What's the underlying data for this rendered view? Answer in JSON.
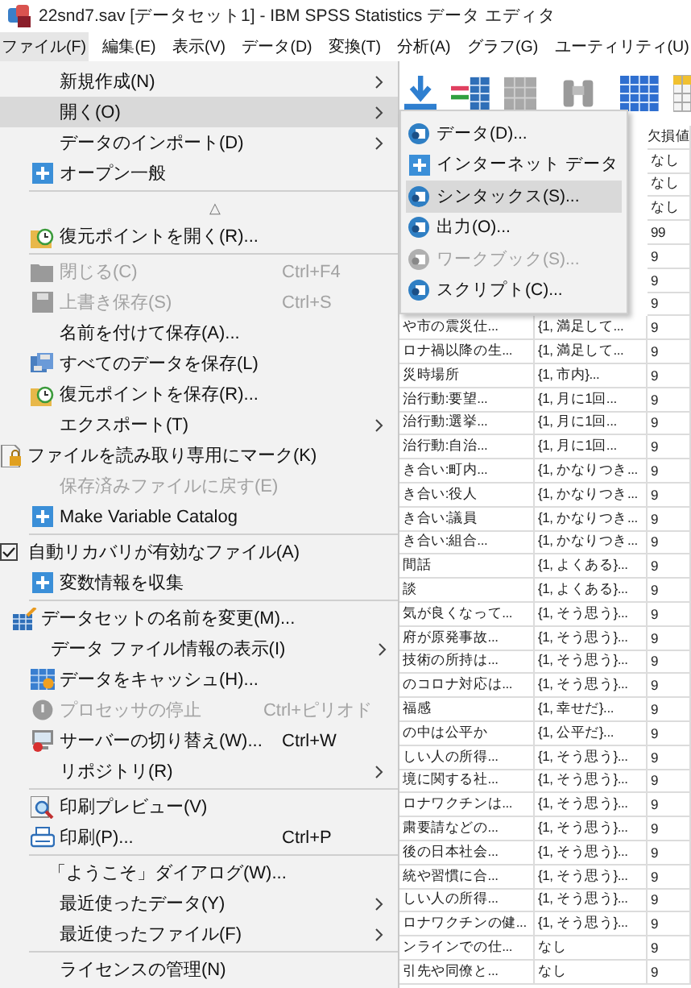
{
  "window": {
    "title": "22snd7.sav [データセット1] - IBM SPSS Statistics データ エディタ"
  },
  "menubar": [
    {
      "label": "ファイル(F)",
      "selected": true
    },
    {
      "label": "編集(E)",
      "selected": false
    },
    {
      "label": "表示(V)",
      "selected": false
    },
    {
      "label": "データ(D)",
      "selected": false
    },
    {
      "label": "変換(T)",
      "selected": false
    },
    {
      "label": "分析(A)",
      "selected": false
    },
    {
      "label": "グラフ(G)",
      "selected": false
    },
    {
      "label": "ユーティリティ(U)",
      "selected": false
    }
  ],
  "file_menu": {
    "items": [
      {
        "kind": "item",
        "label": "新規作成(N)",
        "has_submenu": true,
        "selected": false,
        "disabled": false
      },
      {
        "kind": "item",
        "label": "開く(O)",
        "has_submenu": true,
        "selected": true,
        "disabled": false
      },
      {
        "kind": "item",
        "label": "データのインポート(D)",
        "has_submenu": true,
        "selected": false,
        "disabled": false
      },
      {
        "kind": "item",
        "label": "オープン一般",
        "selected": false,
        "disabled": false
      },
      {
        "kind": "separator"
      },
      {
        "kind": "more",
        "label": "△"
      },
      {
        "kind": "item",
        "label": "復元ポイントを開く(R)...",
        "selected": false,
        "disabled": false
      },
      {
        "kind": "separator"
      },
      {
        "kind": "item",
        "label": "閉じる(C)",
        "shortcut": "Ctrl+F4",
        "selected": false,
        "disabled": true
      },
      {
        "kind": "item",
        "label": "上書き保存(S)",
        "shortcut": "Ctrl+S",
        "selected": false,
        "disabled": true
      },
      {
        "kind": "item",
        "label": "名前を付けて保存(A)...",
        "selected": false,
        "disabled": false
      },
      {
        "kind": "item",
        "label": "すべてのデータを保存(L)",
        "selected": false,
        "disabled": false
      },
      {
        "kind": "item",
        "label": "復元ポイントを保存(R)...",
        "selected": false,
        "disabled": false
      },
      {
        "kind": "item",
        "label": "エクスポート(T)",
        "has_submenu": true,
        "selected": false,
        "disabled": false
      },
      {
        "kind": "item",
        "label": "ファイルを読み取り専用にマーク(K)",
        "selected": false,
        "disabled": false
      },
      {
        "kind": "item",
        "label": "保存済みファイルに戻す(E)",
        "selected": false,
        "disabled": true
      },
      {
        "kind": "item",
        "label": "Make Variable Catalog",
        "selected": false,
        "disabled": false
      },
      {
        "kind": "separator"
      },
      {
        "kind": "check",
        "label": "自動リカバリが有効なファイル(A)",
        "checked": true,
        "selected": false,
        "disabled": false
      },
      {
        "kind": "item",
        "label": "変数情報を収集",
        "selected": false,
        "disabled": false
      },
      {
        "kind": "separator"
      },
      {
        "kind": "item",
        "label": "データセットの名前を変更(M)...",
        "selected": false,
        "disabled": false
      },
      {
        "kind": "item",
        "label": "データ ファイル情報の表示(I)",
        "has_submenu": true,
        "selected": false,
        "disabled": false
      },
      {
        "kind": "item",
        "label": "データをキャッシュ(H)...",
        "selected": false,
        "disabled": false
      },
      {
        "kind": "item",
        "label": "プロセッサの停止",
        "shortcut": "Ctrl+ピリオド",
        "selected": false,
        "disabled": true
      },
      {
        "kind": "item",
        "label": "サーバーの切り替え(W)...",
        "shortcut": "Ctrl+W",
        "selected": false,
        "disabled": false
      },
      {
        "kind": "item",
        "label": "リポジトリ(R)",
        "has_submenu": true,
        "selected": false,
        "disabled": false
      },
      {
        "kind": "separator"
      },
      {
        "kind": "item",
        "label": "印刷プレビュー(V)",
        "selected": false,
        "disabled": false
      },
      {
        "kind": "item",
        "label": "印刷(P)...",
        "shortcut": "Ctrl+P",
        "selected": false,
        "disabled": false
      },
      {
        "kind": "separator"
      },
      {
        "kind": "item",
        "label": "「ようこそ」ダイアログ(W)...",
        "selected": false,
        "disabled": false
      },
      {
        "kind": "item",
        "label": "最近使ったデータ(Y)",
        "has_submenu": true,
        "selected": false,
        "disabled": false
      },
      {
        "kind": "item",
        "label": "最近使ったファイル(F)",
        "has_submenu": true,
        "selected": false,
        "disabled": false
      },
      {
        "kind": "separator"
      },
      {
        "kind": "item",
        "label": "ライセンスの管理(N)",
        "selected": false,
        "disabled": false
      }
    ]
  },
  "open_submenu": {
    "items": [
      {
        "label": "データ(D)...",
        "selected": false,
        "disabled": false
      },
      {
        "label": "インターネット データ",
        "selected": false,
        "disabled": false
      },
      {
        "label": "シンタックス(S)...",
        "selected": true,
        "disabled": false
      },
      {
        "label": "出力(O)...",
        "selected": false,
        "disabled": false
      },
      {
        "label": "ワークブック(S)...",
        "selected": false,
        "disabled": true
      },
      {
        "label": "スクリプト(C)...",
        "selected": false,
        "disabled": false
      }
    ]
  },
  "grid": {
    "header_column_3": "欠損値",
    "rows": [
      {
        "column_3": "なし"
      },
      {
        "column_3": "なし"
      },
      {
        "column_3": "なし"
      },
      {
        "column_3": "99"
      },
      {
        "column_3": "9"
      },
      {
        "column_3": "9"
      },
      {
        "column_3": "9"
      },
      {
        "column_1": "や市の震災仕...",
        "column_2": "{1, 満足して...",
        "column_3": "9"
      },
      {
        "column_1": "ロナ禍以降の生...",
        "column_2": "{1, 満足して...",
        "column_3": "9"
      },
      {
        "column_1": "災時場所",
        "column_2": "{1, 市内}...",
        "column_3": "9"
      },
      {
        "column_1": "治行動:要望...",
        "column_2": "{1, 月に1回...",
        "column_3": "9"
      },
      {
        "column_1": "治行動:選挙...",
        "column_2": "{1, 月に1回...",
        "column_3": "9"
      },
      {
        "column_1": "治行動:自治...",
        "column_2": "{1, 月に1回...",
        "column_3": "9"
      },
      {
        "column_1": "き合い:町内...",
        "column_2": "{1, かなりつき...",
        "column_3": "9"
      },
      {
        "column_1": "き合い:役人",
        "column_2": "{1, かなりつき...",
        "column_3": "9"
      },
      {
        "column_1": "き合い:議員",
        "column_2": "{1, かなりつき...",
        "column_3": "9"
      },
      {
        "column_1": "き合い:組合...",
        "column_2": "{1, かなりつき...",
        "column_3": "9"
      },
      {
        "column_1": "間話",
        "column_2": "{1, よくある}...",
        "column_3": "9"
      },
      {
        "column_1": "談",
        "column_2": "{1, よくある}...",
        "column_3": "9"
      },
      {
        "column_1": "気が良くなって...",
        "column_2": "{1, そう思う}...",
        "column_3": "9"
      },
      {
        "column_1": "府が原発事故...",
        "column_2": "{1, そう思う}...",
        "column_3": "9"
      },
      {
        "column_1": "技術の所持は...",
        "column_2": "{1, そう思う}...",
        "column_3": "9"
      },
      {
        "column_1": "のコロナ対応は...",
        "column_2": "{1, そう思う}...",
        "column_3": "9"
      },
      {
        "column_1": "福感",
        "column_2": "{1, 幸せだ}...",
        "column_3": "9"
      },
      {
        "column_1": "の中は公平か",
        "column_2": "{1, 公平だ}...",
        "column_3": "9"
      },
      {
        "column_1": "しい人の所得...",
        "column_2": "{1, そう思う}...",
        "column_3": "9"
      },
      {
        "column_1": "境に関する社...",
        "column_2": "{1, そう思う}...",
        "column_3": "9"
      },
      {
        "column_1": "ロナワクチンは...",
        "column_2": "{1, そう思う}...",
        "column_3": "9"
      },
      {
        "column_1": "粛要請などの...",
        "column_2": "{1, そう思う}...",
        "column_3": "9"
      },
      {
        "column_1": "後の日本社会...",
        "column_2": "{1, そう思う}...",
        "column_3": "9"
      },
      {
        "column_1": "統や習慣に合...",
        "column_2": "{1, そう思う}...",
        "column_3": "9"
      },
      {
        "column_1": "しい人の所得...",
        "column_2": "{1, そう思う}...",
        "column_3": "9"
      },
      {
        "column_1": "ロナワクチンの健...",
        "column_2": "{1, そう思う}...",
        "column_3": "9"
      },
      {
        "column_1": "ンラインでの仕...",
        "column_2": "なし",
        "column_3": "9"
      },
      {
        "column_1": "引先や同僚と...",
        "column_2": "なし",
        "column_3": "9"
      }
    ]
  }
}
